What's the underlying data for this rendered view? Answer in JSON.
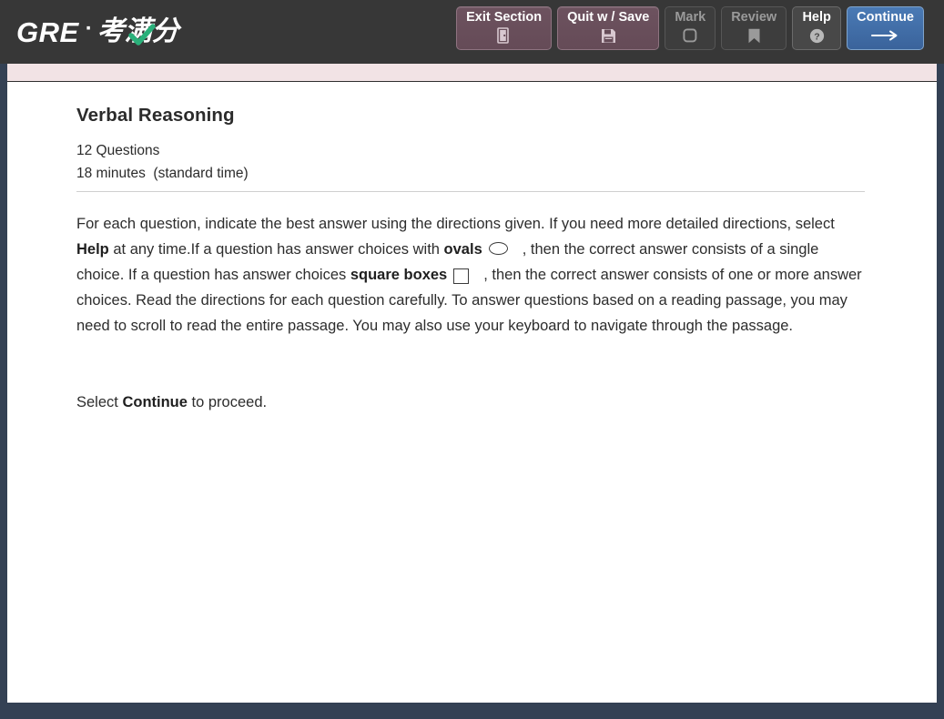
{
  "app": {
    "logo": {
      "gre": "GRE",
      "separator": "·",
      "chinese": "考满分",
      "check_icon": "check-icon",
      "check_color": "#2ab07a"
    },
    "accent_blue": "#3a639b",
    "toolbar_bg": "#373737",
    "frame_color": "#344154",
    "strip_color": "#f2e3e5"
  },
  "toolbar": {
    "buttons": [
      {
        "label": "Exit Section",
        "icon": "exit-door-icon",
        "style": "mauve",
        "enabled": true
      },
      {
        "label": "Quit w / Save",
        "icon": "save-disk-icon",
        "style": "mauve",
        "enabled": true
      },
      {
        "label": "Mark",
        "icon": "rounded-square-icon",
        "style": "dark",
        "enabled": false
      },
      {
        "label": "Review",
        "icon": "bookmark-icon",
        "style": "dark",
        "enabled": false
      },
      {
        "label": "Help",
        "icon": "question-circle-icon",
        "style": "darkon",
        "enabled": true
      },
      {
        "label": "Continue",
        "icon": "arrow-right-icon",
        "style": "blue",
        "enabled": true
      }
    ]
  },
  "content": {
    "section_title": "Verbal Reasoning",
    "question_count": "12 Questions",
    "time_limit": "18 minutes  (standard time)",
    "directions": {
      "part1": "For each question, indicate the best answer using the directions given. If you need more detailed directions, select ",
      "help_bold": "Help",
      "part2": " at any time.If a question has answer choices with ",
      "ovals_bold": "ovals",
      "oval_symbol": "oval-symbol",
      "part3": ", then the correct answer consists of a single choice. If a question has answer choices ",
      "square_bold": "square boxes",
      "square_symbol": "square-box-symbol",
      "part4": ", then the correct answer consists of one or more answer choices. Read the directions for each question carefully. To answer questions based on a reading passage, you may need to scroll to read the entire passage. You may also use your keyboard to navigate through the passage."
    },
    "proceed": {
      "prefix": "Select ",
      "bold": "Continue",
      "suffix": " to proceed."
    }
  }
}
